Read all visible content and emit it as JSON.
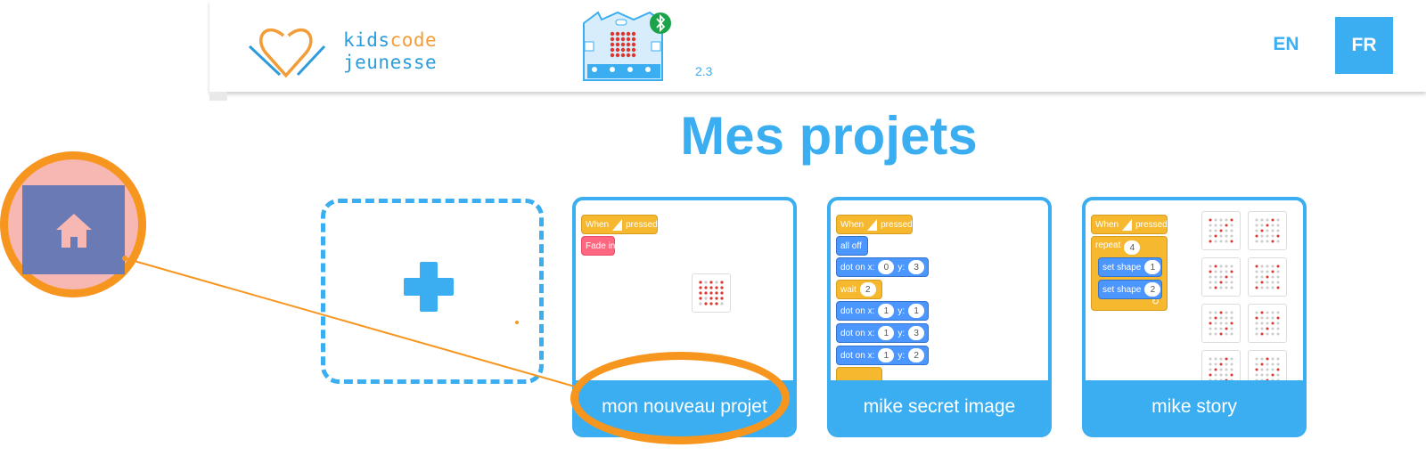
{
  "header": {
    "logo_part1": "kids",
    "logo_part2": "code",
    "logo_part3": "jeunesse",
    "version": "2.3",
    "lang_en": "EN",
    "lang_fr": "FR"
  },
  "page_title": "Mes projets",
  "icons": {
    "home": "home-icon",
    "add": "plus-icon",
    "bluetooth": "bluetooth-icon"
  },
  "projects": [
    {
      "name": "mon nouveau projet",
      "blocks": {
        "hat_when": "When",
        "hat_pressed": "pressed",
        "fade": "Fade in"
      }
    },
    {
      "name": "mike secret image",
      "blocks": {
        "hat_when": "When",
        "hat_pressed": "pressed",
        "all_off": "all off",
        "dot_label": "dot on x:",
        "y_label": "y:",
        "d1x": "0",
        "d1y": "3",
        "wait": "wait",
        "wait_val": "2",
        "d2x": "1",
        "d2y": "1",
        "d3x": "1",
        "d3y": "3",
        "d4x": "1",
        "d4y": "2"
      }
    },
    {
      "name": "mike story",
      "blocks": {
        "hat_when": "When",
        "hat_pressed": "pressed",
        "repeat": "repeat",
        "repeat_val": "4",
        "set_shape": "set shape",
        "s1": "1",
        "s2": "2"
      }
    }
  ],
  "colors": {
    "accent": "#3aaef0",
    "annotation": "#f7961e",
    "event_block": "#f5b82e",
    "looks_block": "#4c97ff",
    "effect_block": "#ff6680"
  }
}
